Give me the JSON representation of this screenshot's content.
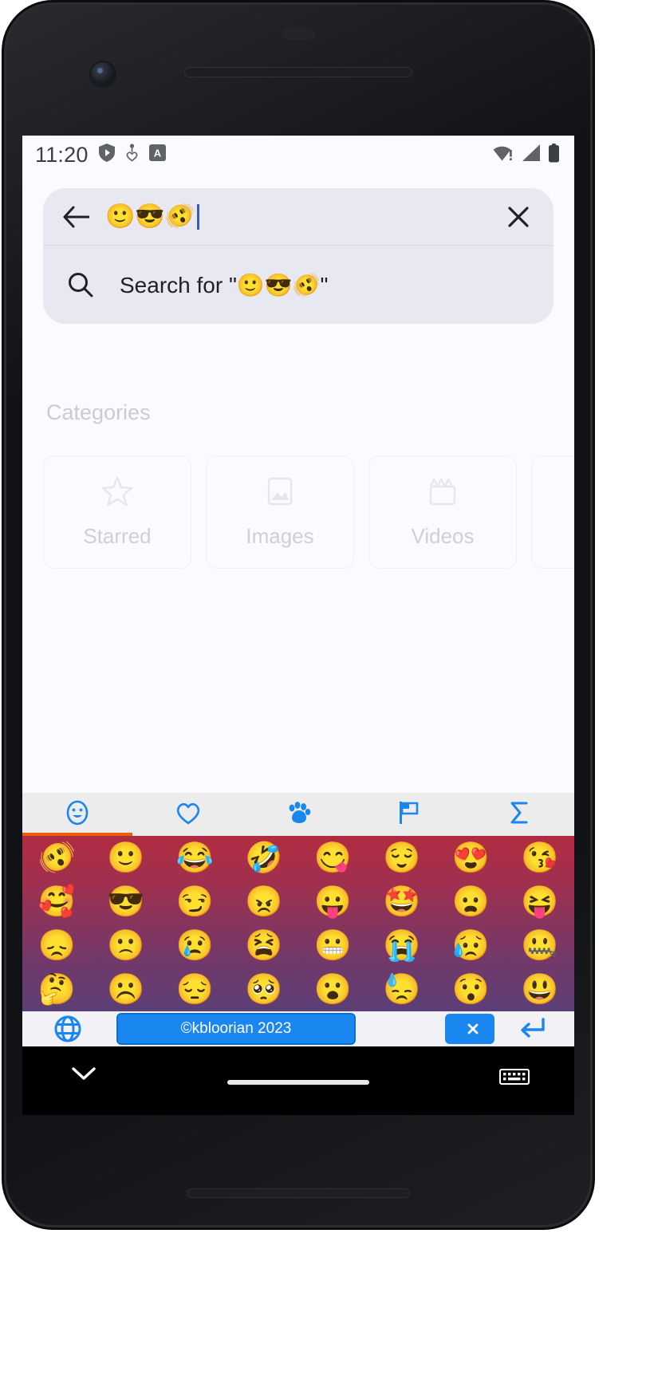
{
  "status_bar": {
    "time": "11:20",
    "left_icons": [
      "shield-play-icon",
      "heart-person-icon",
      "app-badge-a-icon"
    ],
    "right_icons": [
      "wifi-no-internet-icon",
      "cellular-signal-icon",
      "battery-full-icon"
    ]
  },
  "search": {
    "back_icon": "back-arrow-icon",
    "query": "🙂😎🫨",
    "clear_icon": "close-x-icon",
    "suggestion_icon": "search-icon",
    "suggestion_text": "Search for \"🙂😎🫨\""
  },
  "content": {
    "categories_title": "Categories",
    "cards": [
      {
        "label": "Starred",
        "icon": "star-outline-icon"
      },
      {
        "label": "Images",
        "icon": "image-outline-icon"
      },
      {
        "label": "Videos",
        "icon": "clapperboard-outline-icon"
      },
      {
        "label": "",
        "icon": ""
      }
    ]
  },
  "keyboard": {
    "tabs": [
      {
        "name": "smileys",
        "icon": "smiley-face-icon",
        "active": true
      },
      {
        "name": "hearts",
        "icon": "heart-outline-icon",
        "active": false
      },
      {
        "name": "animals",
        "icon": "paw-print-icon",
        "active": false
      },
      {
        "name": "flags",
        "icon": "flag-icon",
        "active": false
      },
      {
        "name": "symbols",
        "icon": "sigma-symbol-icon",
        "active": false
      }
    ],
    "active_tab_indicator_color": "#e8610a",
    "gradient_top_color": "#b12c41",
    "gradient_bottom_color": "#5b3f76",
    "emoji_rows": [
      [
        "🫨",
        "🙂",
        "😂",
        "🤣",
        "😋",
        "😌",
        "😍",
        "😘"
      ],
      [
        "🥰",
        "😎",
        "😏",
        "😠",
        "😛",
        "🤩",
        "😦",
        "😝"
      ],
      [
        "😞",
        "🙁",
        "😢",
        "😫",
        "😬",
        "😭",
        "😥",
        "🤐"
      ],
      [
        "🤔",
        "☹️",
        "😔",
        "🥺",
        "😮",
        "😓",
        "😯",
        "😃"
      ]
    ],
    "bottom_bar": {
      "globe_icon": "globe-language-icon",
      "suggestion_chip": "©kbloorian 2023",
      "backspace_icon": "backspace-x-icon",
      "enter_icon": "enter-return-icon",
      "key_color": "#1a86f0"
    }
  },
  "nav_bar": {
    "down_icon": "chevron-down-icon",
    "keyboard_icon": "keyboard-icon",
    "home_pill": "home-gesture-pill"
  }
}
